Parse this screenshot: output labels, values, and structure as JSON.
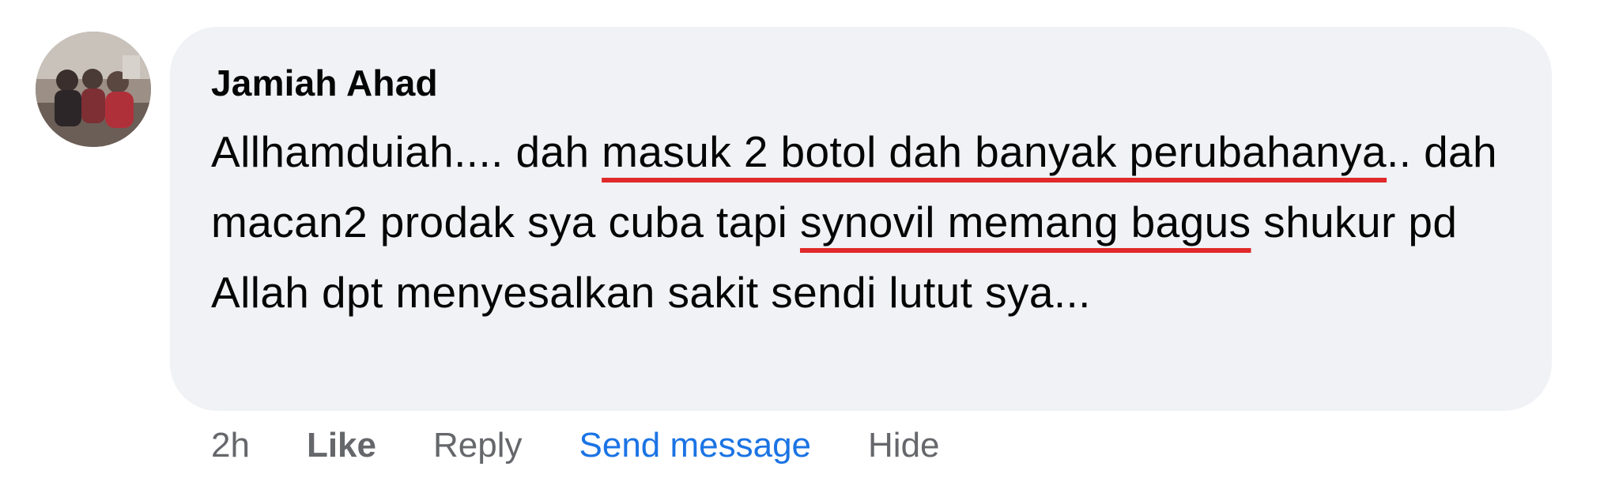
{
  "comment": {
    "author": "Jamiah Ahad",
    "segments": [
      {
        "text": "Allhamduiah.... dah ",
        "underlined": false
      },
      {
        "text": "masuk 2 botol dah banyak perubahanya",
        "underlined": true
      },
      {
        "text": ".. dah macan2 prodak sya cuba tapi ",
        "underlined": false
      },
      {
        "text": "synovil memang bagus",
        "underlined": true
      },
      {
        "text": " shukur pd Allah dpt menyesalkan sakit sendi lutut sya...",
        "underlined": false
      }
    ]
  },
  "actions": {
    "time": "2h",
    "like": "Like",
    "reply": "Reply",
    "send_message": "Send message",
    "hide": "Hide"
  },
  "colors": {
    "bubble": "#f0f2f5",
    "text": "#050505",
    "meta": "#65676b",
    "link_blue": "#1b74e4",
    "annotation_red": "#e0292a"
  }
}
